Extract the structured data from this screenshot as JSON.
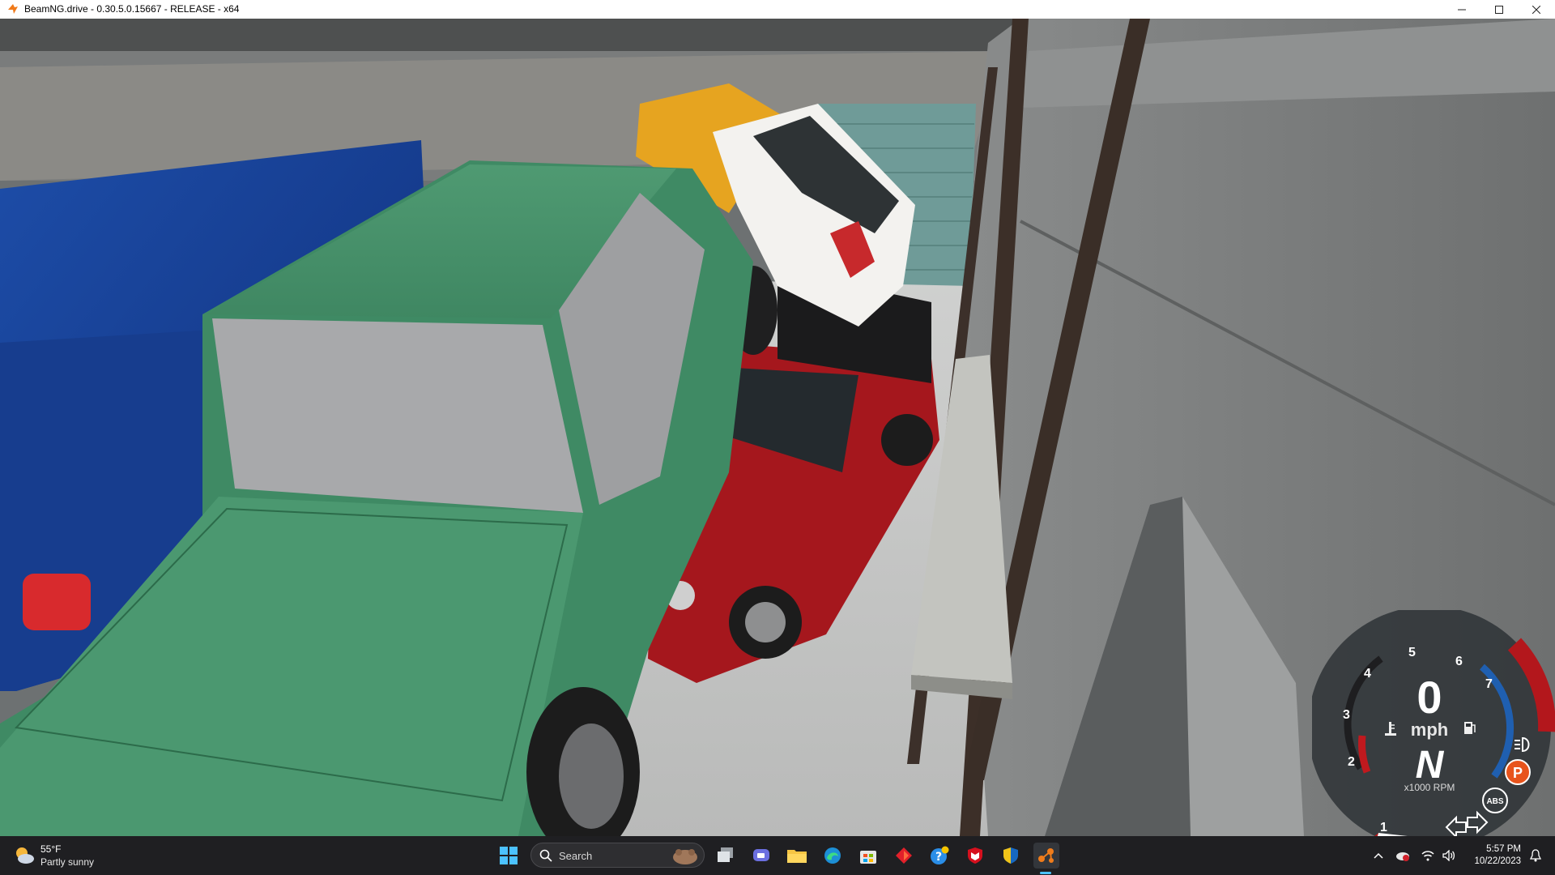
{
  "window": {
    "title": "BeamNG.drive - 0.30.5.0.15667 - RELEASE - x64"
  },
  "hud": {
    "speed": "0",
    "speed_unit": "mph",
    "gear": "N",
    "rpm_label": "x1000 RPM",
    "rpm_ticks": [
      "1",
      "2",
      "3",
      "4",
      "5",
      "6",
      "7"
    ],
    "parking_brake": "P",
    "abs": "ABS",
    "rpm_fraction": 0.0,
    "accent_red": "#c0191e",
    "accent_blue": "#1f5fb0"
  },
  "taskbar": {
    "weather_temp": "55°F",
    "weather_condition": "Partly sunny",
    "search_placeholder": "Search",
    "time": "5:57 PM",
    "date": "10/22/2023",
    "apps": [
      "windows-start-icon",
      "task-view-icon",
      "teams-chat-icon",
      "file-explorer-icon",
      "edge-browser-icon",
      "microsoft-store-icon",
      "red-diamond-app-icon",
      "help-icon",
      "mcafee-shield-icon",
      "security-shield-icon",
      "beamng-icon"
    ]
  }
}
